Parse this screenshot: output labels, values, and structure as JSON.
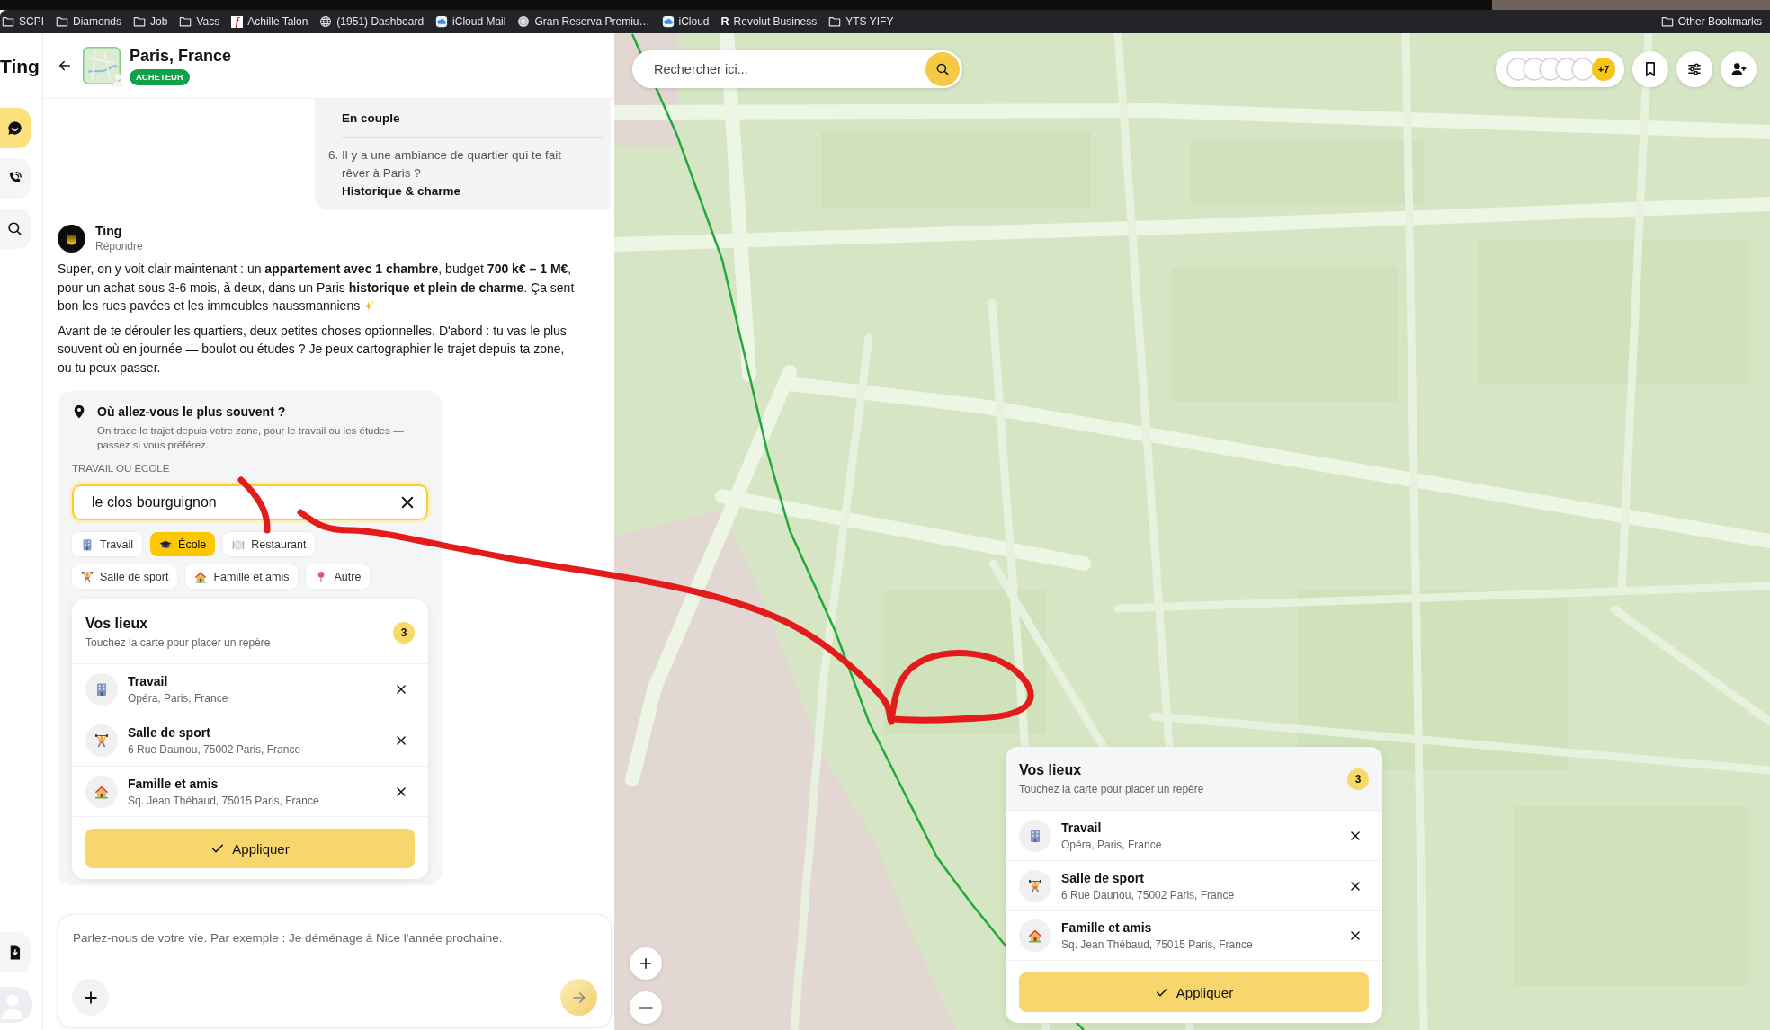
{
  "browser": {
    "bookmarks": [
      {
        "label": "SCPI",
        "kind": "folder"
      },
      {
        "label": "Diamonds",
        "kind": "folder"
      },
      {
        "label": "Job",
        "kind": "folder"
      },
      {
        "label": "Vacs",
        "kind": "folder"
      },
      {
        "label": "Achille Talon",
        "kind": "tile",
        "glyph": "f"
      },
      {
        "label": "(1951) Dashboard",
        "kind": "globe"
      },
      {
        "label": "iCloud Mail",
        "kind": "cloud"
      },
      {
        "label": "Gran Reserva Premiu…",
        "kind": "seal"
      },
      {
        "label": "iCloud",
        "kind": "cloud"
      },
      {
        "label": "Revolut Business",
        "kind": "letter",
        "glyph": "R"
      },
      {
        "label": "YTS YIFY",
        "kind": "folder"
      }
    ],
    "other_bookmarks": {
      "label": "Other Bookmarks",
      "kind": "folder"
    }
  },
  "sidebar": {
    "logo": "Ting",
    "items": [
      {
        "kind": "chat",
        "selected": true
      },
      {
        "kind": "call",
        "selected": false
      },
      {
        "kind": "search",
        "selected": false
      }
    ]
  },
  "header": {
    "title": "Paris, France",
    "badge": "ACHETEUR"
  },
  "user_message": {
    "answers": [
      {
        "answer": "En couple"
      },
      {
        "number": "6.",
        "question": "Il y a une ambiance de quartier qui te fait rêver à Paris ?",
        "answer": "Historique & charme"
      }
    ]
  },
  "bot_message": {
    "name": "Ting",
    "action": "Répondre",
    "paragraphs": [
      {
        "text": "Super, on y voit clair maintenant : un **appartement avec 1 chambre**, budget **700 k€ – 1 M€**, pour un achat sous 3-6 mois, à deux, dans un Paris **historique et plein de charme**. Ça sent bon les rues pavées et les immeubles haussmanniens",
        "sparkle": true
      },
      {
        "text": "Avant de te dérouler les quartiers, deux petites choses optionnelles. D'abord : tu vas le plus souvent où en journée — boulot ou études ? Je peux cartographier le trajet depuis ta zone, ou tu peux passer.",
        "sparkle": false
      }
    ]
  },
  "commute_card": {
    "title": "Où allez-vous le plus souvent ?",
    "hint": "On trace le trajet depuis votre zone, pour le travail ou les études — passez si vous préférez.",
    "field_label": "TRAVAIL OU ÉCOLE",
    "field": {
      "value": "le clos bourguignon",
      "focused": true
    },
    "categories": [
      {
        "label": "Travail",
        "kind": "work",
        "selected": false
      },
      {
        "label": "École",
        "kind": "school",
        "selected": true
      },
      {
        "label": "Restaurant",
        "kind": "restaurant",
        "selected": false
      },
      {
        "label": "Salle de sport",
        "kind": "gym",
        "selected": false
      },
      {
        "label": "Famille et amis",
        "kind": "family",
        "selected": false
      },
      {
        "label": "Autre",
        "kind": "other",
        "selected": false
      }
    ],
    "places": {
      "title": "Vos lieux",
      "hint": "Touchez la carte pour placer un repère",
      "count": "3",
      "items": [
        {
          "kind": "work",
          "name": "Travail",
          "address": "Opéra, Paris, France"
        },
        {
          "kind": "gym",
          "name": "Salle de sport",
          "address": "6 Rue Daunou, 75002 Paris, France"
        },
        {
          "kind": "family",
          "name": "Famille et amis",
          "address": "Sq. Jean Thébaud, 75015 Paris, France"
        }
      ],
      "apply": "Appliquer"
    }
  },
  "composer": {
    "placeholder": "Parlez-nous de votre vie. Par exemple : Je déménage à Nice l'année prochaine."
  },
  "map": {
    "search": {
      "placeholder": "Rechercher ici..."
    },
    "collaborators": {
      "more": "+7"
    },
    "places_panel": {
      "title": "Vos lieux",
      "hint": "Touchez la carte pour placer un repère",
      "count": "3",
      "items": [
        {
          "kind": "work",
          "name": "Travail",
          "address": "Opéra, Paris, France"
        },
        {
          "kind": "gym",
          "name": "Salle de sport",
          "address": "6 Rue Daunou, 75002 Paris, France"
        },
        {
          "kind": "family",
          "name": "Famille et amis",
          "address": "Sq. Jean Thébaud, 75015 Paris, France"
        }
      ],
      "apply": "Appliquer"
    }
  }
}
